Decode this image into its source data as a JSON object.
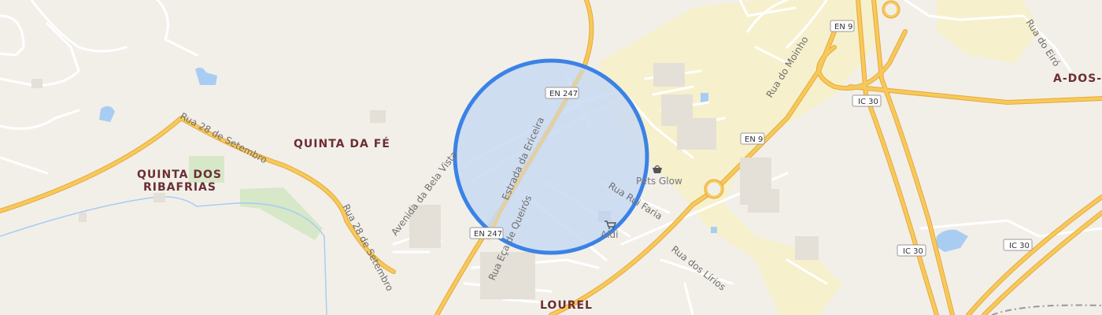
{
  "map": {
    "place_labels": [
      "QUINTA DA FÉ",
      "QUINTA DOS",
      "RIBAFRIAS",
      "LOUREL",
      "A-DOS-C"
    ],
    "street_labels": [
      "Rua 28 de Setembro",
      "Rua 28 de Setembro",
      "Avenida da Bela Vista",
      "Estrada da Ericeira",
      "Rua Eça de Queirós",
      "Rua Rui Faria",
      "Rua dos Lírios",
      "Rua do Moinho",
      "Rua do Eiró"
    ],
    "road_shields": [
      "EN 247",
      "EN 247",
      "EN 9",
      "EN 9",
      "IC 30",
      "IC 30",
      "IC 30"
    ],
    "pois": [
      {
        "name": "Pets Glow",
        "icon": "shop-basket-icon"
      },
      {
        "name": "Aldi",
        "icon": "shopping-cart-icon"
      }
    ],
    "selection_circle": {
      "fill": "#c9d9f2",
      "stroke": "#3b82e6"
    },
    "colors": {
      "background": "#f2efe9",
      "major_road": "#f7c95b",
      "major_road_casing": "#e6a93b",
      "minor_road": "#ffffff",
      "industrial": "#f6efc9",
      "park": "#d6e8c8",
      "water": "#a9cdf2",
      "place_label": "#6b2f33"
    }
  }
}
